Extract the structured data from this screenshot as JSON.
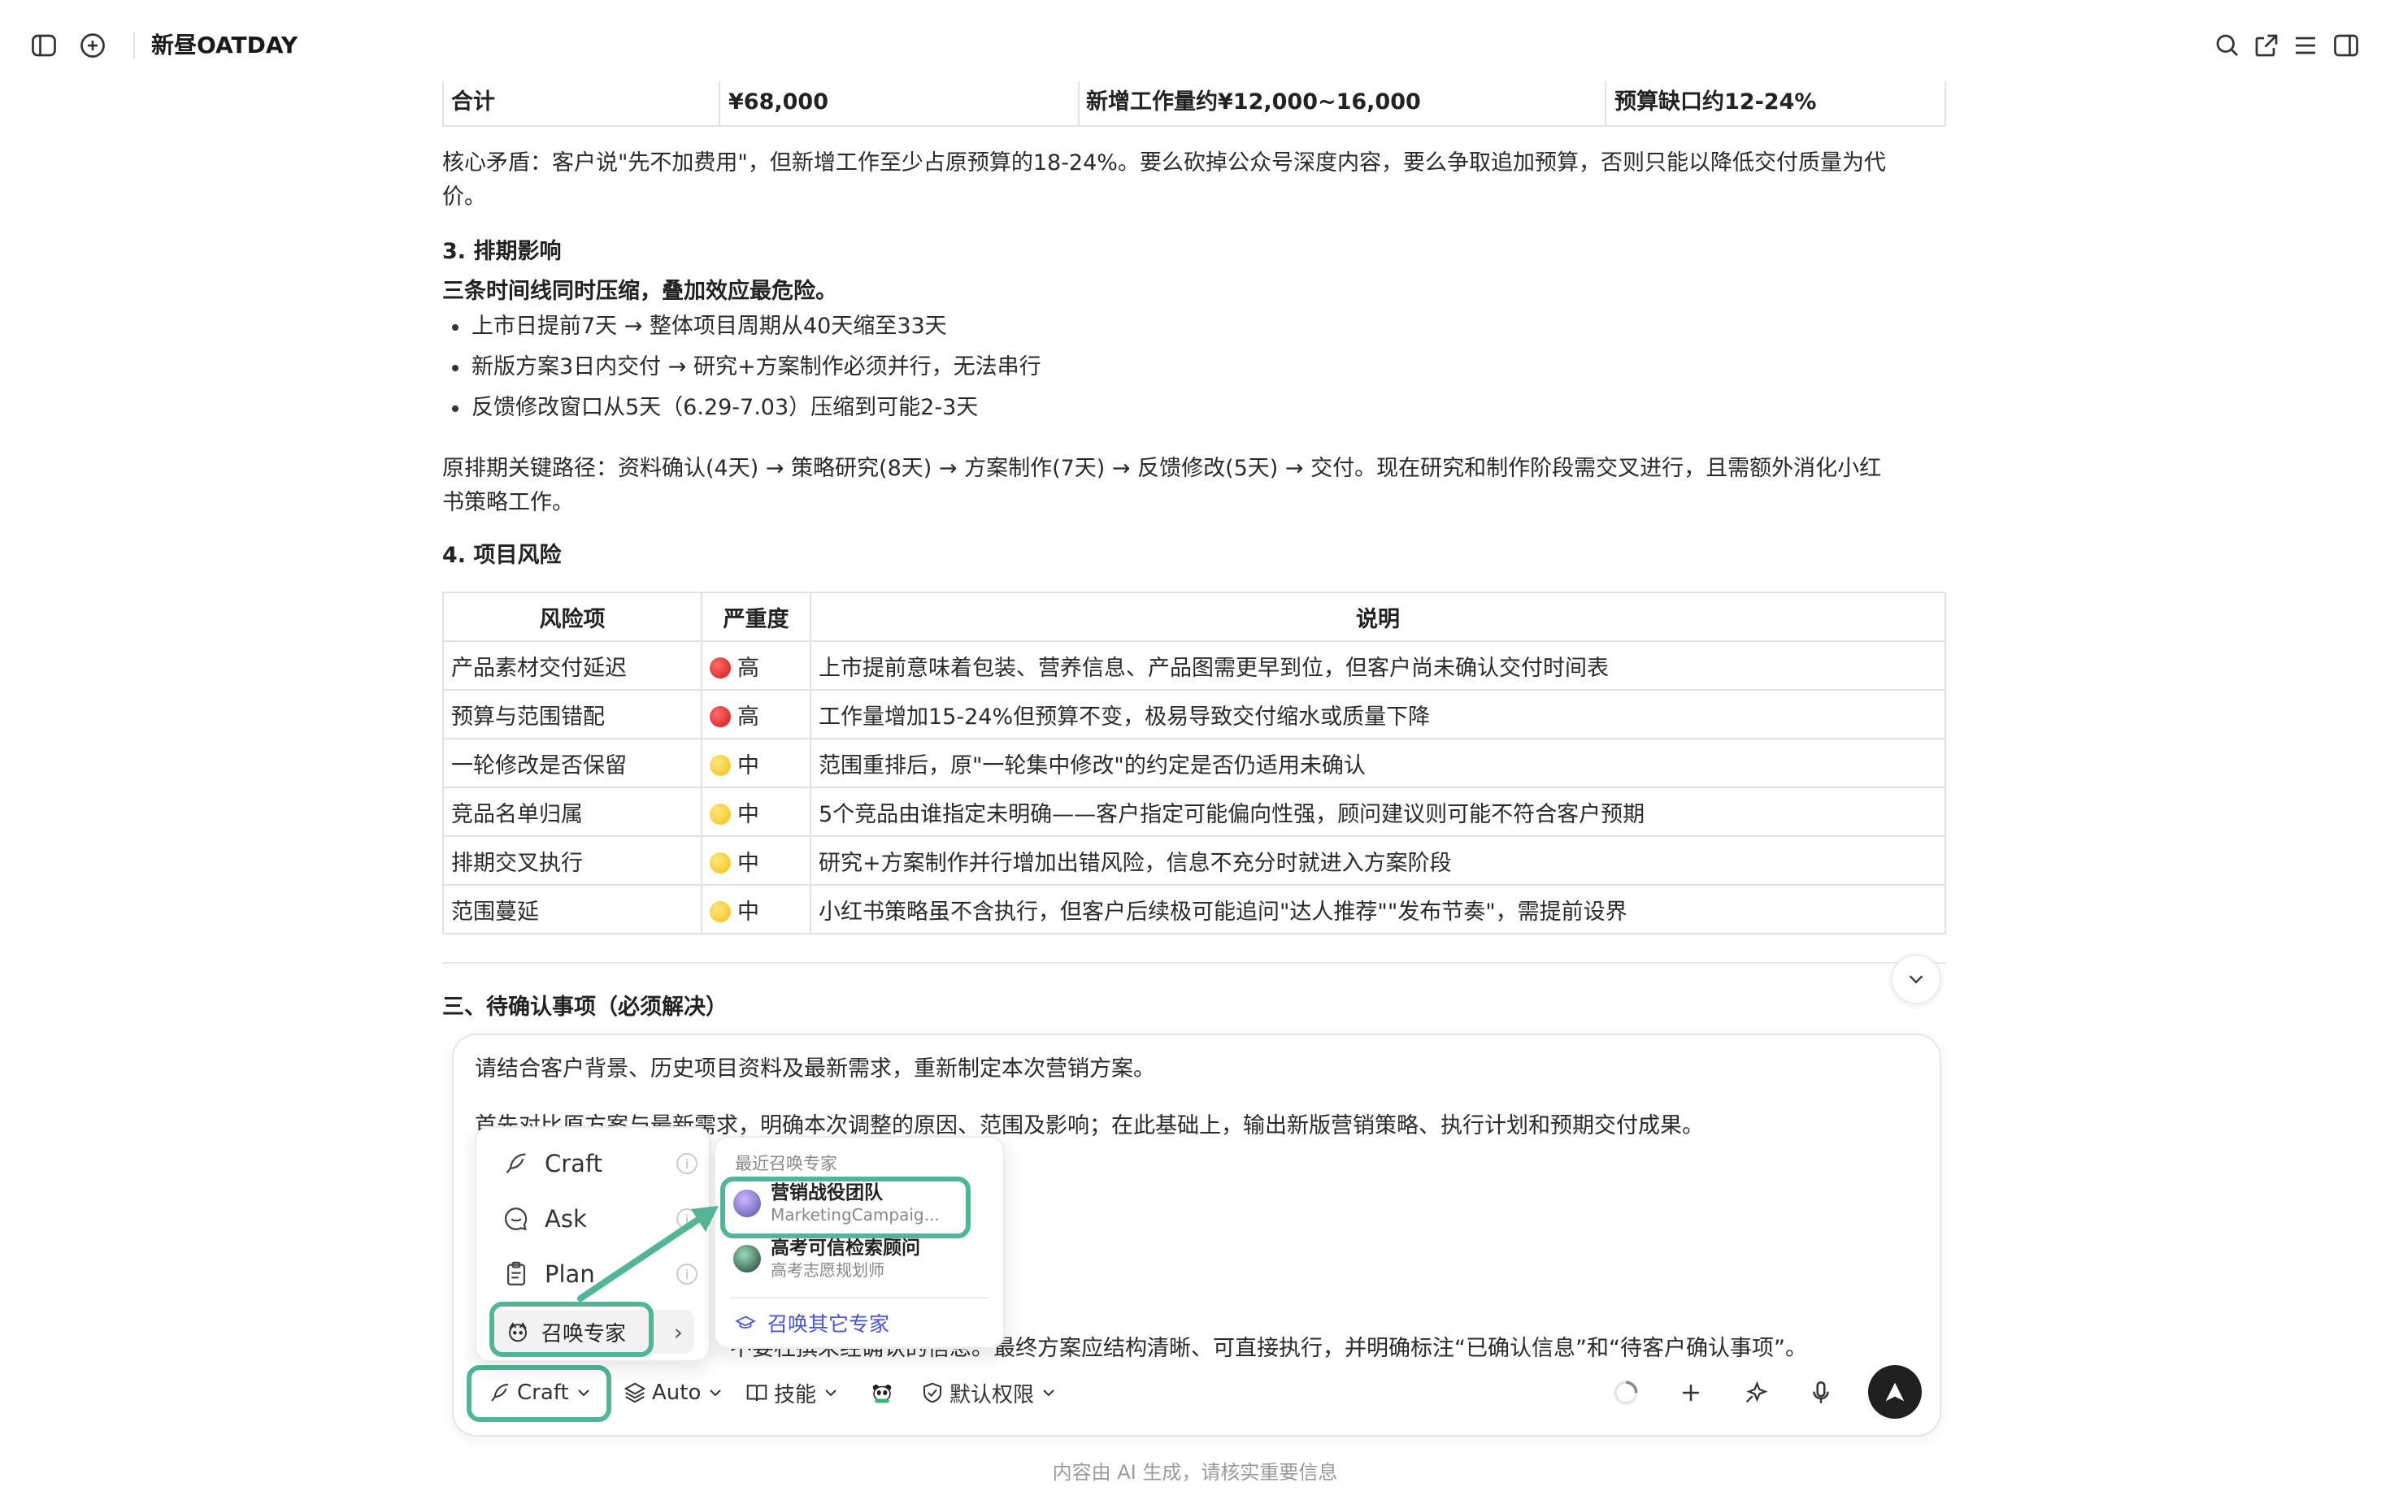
{
  "header": {
    "title": "新昼OATDAY"
  },
  "total_row": {
    "label": "合计",
    "amount": "¥68,000",
    "added": "新增工作量约¥12,000~16,000",
    "gap": "预算缺口约12-24%"
  },
  "core_conflict": {
    "line1": "核心矛盾：客户说\"先不加费用\"，但新增工作至少占原预算的18-24%。要么砍掉公众号深度内容，要么争取追加预算，否则只能以降低交付质量为代",
    "line2": "价。"
  },
  "section3": {
    "heading": "3. 排期影响",
    "subheading": "三条时间线同时压缩，叠加效应最危险。",
    "bullets": [
      "上市日提前7天 → 整体项目周期从40天缩至33天",
      "新版方案3日内交付 → 研究+方案制作必须并行，无法串行",
      "反馈修改窗口从5天（6.29-7.03）压缩到可能2-3天"
    ],
    "path_line1": "原排期关键路径：资料确认(4天) → 策略研究(8天) → 方案制作(7天) → 反馈修改(5天) → 交付。现在研究和制作阶段需交叉进行，且需额外消化小红",
    "path_line2": "书策略工作。"
  },
  "section4": {
    "heading": "4. 项目风险",
    "columns": [
      "风险项",
      "严重度",
      "说明"
    ],
    "rows": [
      {
        "item": "产品素材交付延迟",
        "level": "高",
        "color": "red",
        "desc": "上市提前意味着包装、营养信息、产品图需更早到位，但客户尚未确认交付时间表"
      },
      {
        "item": "预算与范围错配",
        "level": "高",
        "color": "red",
        "desc": "工作量增加15-24%但预算不变，极易导致交付缩水或质量下降"
      },
      {
        "item": "一轮修改是否保留",
        "level": "中",
        "color": "yellow",
        "desc": "范围重排后，原\"一轮集中修改\"的约定是否仍适用未确认"
      },
      {
        "item": "竞品名单归属",
        "level": "中",
        "color": "yellow",
        "desc": "5个竞品由谁指定未明确——客户指定可能偏向性强，顾问建议则可能不符合客户预期"
      },
      {
        "item": "排期交叉执行",
        "level": "中",
        "color": "yellow",
        "desc": "研究+方案制作并行增加出错风险，信息不充分时就进入方案阶段"
      },
      {
        "item": "范围蔓延",
        "level": "中",
        "color": "yellow",
        "desc": "小红书策略虽不含执行，但客户后续极可能追问\"达人推荐\"\"发布节奏\"，需提前设界"
      }
    ]
  },
  "section_pending": {
    "heading": "三、待确认事项（必须解决）"
  },
  "composer": {
    "line1": "请结合客户背景、历史项目资料及最新需求，重新制定本次营销方案。",
    "line2_visible": "首先对比原方案与最新需求，明确本次调整的原因、范围及影响；在此基础上，输出新版营销策略、执行计划和预期交付成果。",
    "line_last_visible": "不要杜撰未经确认的信息。最终方案应结构清晰、可直接执行，并明确标注“已确认信息”和“待客户确认事项”。",
    "toolbar": {
      "mode": "Craft",
      "model": "Auto",
      "skills": "技能",
      "permission": "默认权限"
    }
  },
  "mode_menu": {
    "items": [
      "Craft",
      "Ask",
      "Plan"
    ],
    "summon": "召唤专家"
  },
  "experts_menu": {
    "heading": "最近召唤专家",
    "experts": [
      {
        "name": "营销战役团队",
        "desc": "MarketingCampaig..."
      },
      {
        "name": "高考可信检索顾问",
        "desc": "高考志愿规划师"
      }
    ],
    "more": "召唤其它专家"
  },
  "footer": {
    "notice": "内容由 AI 生成，请核实重要信息"
  },
  "colors": {
    "highlight": "#52b597",
    "link": "#4a52d6",
    "risk_high": "#d01919",
    "risk_mid": "#f4c10f"
  }
}
